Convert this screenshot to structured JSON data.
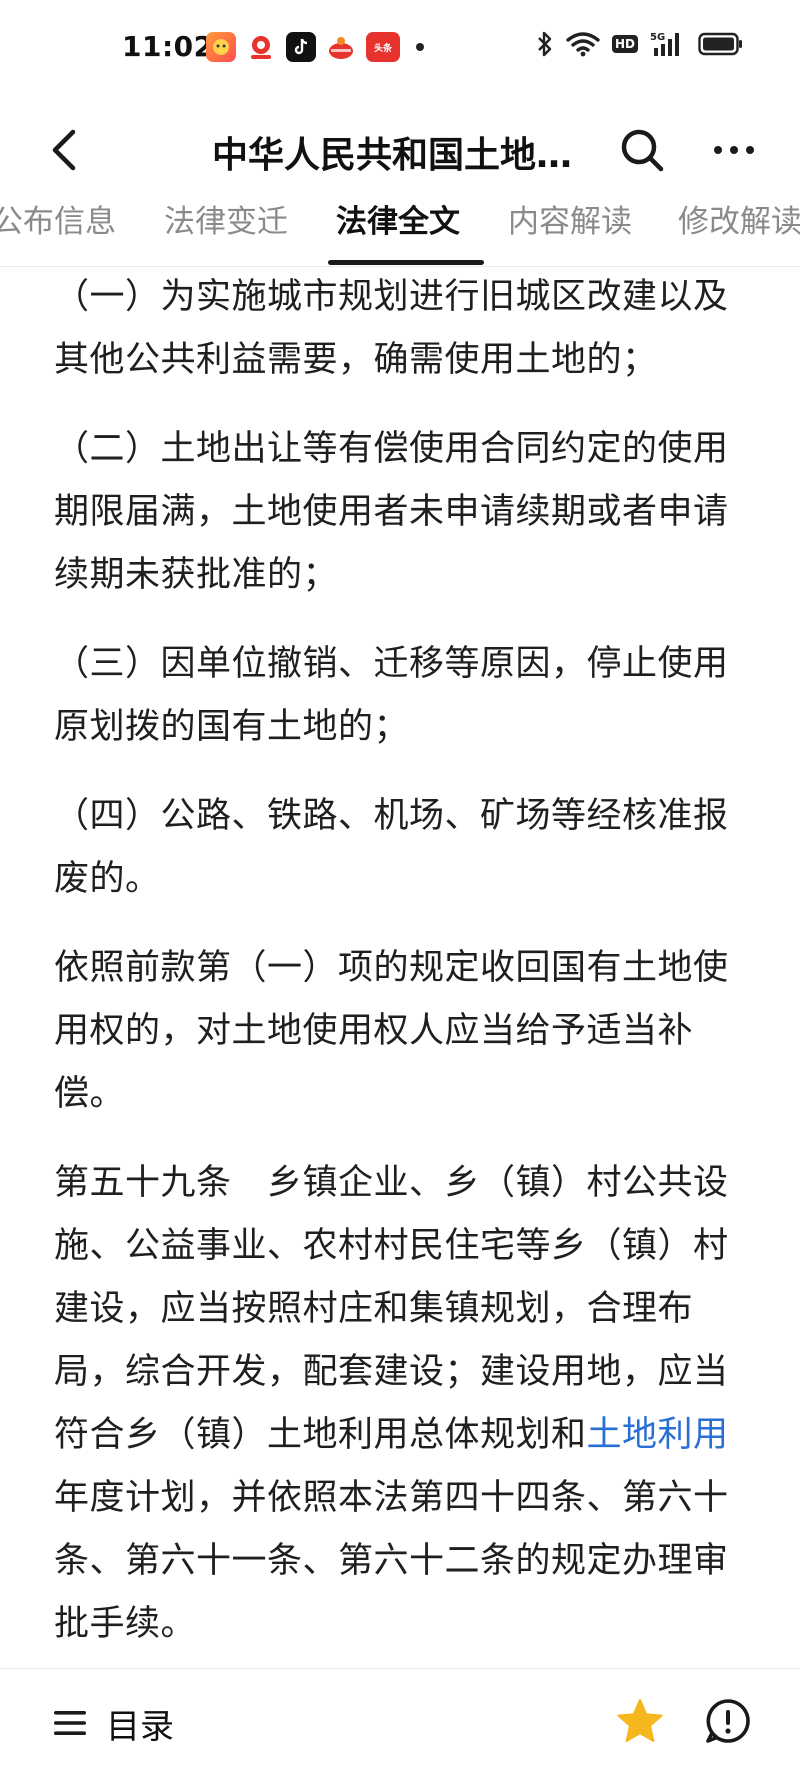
{
  "status_bar": {
    "time": "11:02",
    "notification_icons": [
      "app-icon-1",
      "app-icon-2",
      "tiktok-icon",
      "app-icon-4",
      "toutiao-icon"
    ],
    "toutiao_label": "头条",
    "hd_label": "HD",
    "network_label": "5G",
    "icons": [
      "bluetooth-icon",
      "wifi-icon",
      "hd-icon",
      "signal-icon",
      "battery-icon"
    ]
  },
  "header": {
    "title": "中华人民共和国土地…"
  },
  "tabs": [
    {
      "label": "公布信息",
      "active": false
    },
    {
      "label": "法律变迁",
      "active": false
    },
    {
      "label": "法律全文",
      "active": true
    },
    {
      "label": "内容解读",
      "active": false
    },
    {
      "label": "修改解读",
      "active": false
    }
  ],
  "content": {
    "paragraphs": [
      "（一）为实施城市规划进行旧城区改建以及其他公共利益需要，确需使用土地的；",
      "（二）土地出让等有偿使用合同约定的使用期限届满，土地使用者未申请续期或者申请续期未获批准的；",
      "（三）因单位撤销、迁移等原因，停止使用原划拨的国有土地的；",
      "（四）公路、铁路、机场、矿场等经核准报废的。",
      "依照前款第（一）项的规定收回国有土地使用权的，对土地使用权人应当给予适当补偿。"
    ],
    "article_59": {
      "before_link": "第五十九条　乡镇企业、乡（镇）村公共设施、公益事业、农村村民住宅等乡（镇）村建设，应当按照村庄和集镇规划，合理布局，综合开发，配套建设；建设用地，应当符合乡（镇）土地利用总体规划和",
      "link": "土地利用",
      "after_link": "年度计划，并依照本法第四十四条、第六十条、第六十一条、第六十二条的规定办理审批手续。"
    }
  },
  "bottom_bar": {
    "toc_label": "目录"
  },
  "colors": {
    "link": "#2a6fd3",
    "star": "#f5b71d",
    "text": "#1f1f1f",
    "tab_inactive": "#8a8a8a"
  }
}
